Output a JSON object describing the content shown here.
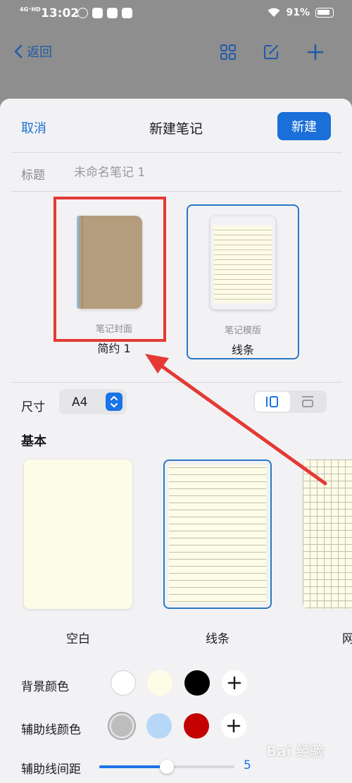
{
  "status_bar": {
    "network": "4G⁺HD",
    "time": "13:02",
    "battery": "91%"
  },
  "background_nav": {
    "back_label": "返回"
  },
  "sheet": {
    "cancel_label": "取消",
    "title": "新建笔记",
    "create_label": "新建",
    "title_field_label": "标题",
    "title_placeholder": "未命名笔记 1",
    "cover": {
      "caption": "笔记封面",
      "name": "简约 1"
    },
    "template": {
      "caption": "笔记模版",
      "name": "线条"
    },
    "size_label": "尺寸",
    "size_value": "A4",
    "section_basic": "基本",
    "papers": [
      {
        "label": "空白"
      },
      {
        "label": "线条"
      },
      {
        "label": "网"
      }
    ],
    "bg_color_label": "背景颜色",
    "bg_colors": [
      "#ffffff",
      "#fdfce6",
      "#000000"
    ],
    "guide_color_label": "辅助线颜色",
    "guide_colors": [
      "#bdbdbd",
      "#b7d7f7",
      "#c40000"
    ],
    "spacing_label": "辅助线间距",
    "spacing_value": "5",
    "spacing_fraction": 0.5
  },
  "annotation": {
    "color": "#e53935"
  },
  "watermark": "Bai 经验"
}
